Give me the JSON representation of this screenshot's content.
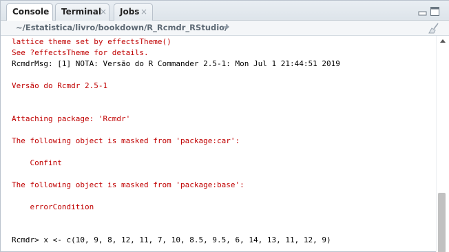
{
  "tabs": [
    {
      "label": "Console",
      "active": true
    },
    {
      "label": "Terminal",
      "close": "×"
    },
    {
      "label": "Jobs",
      "close": "×"
    }
  ],
  "path": "~/Estatistica/livro/bookdown/R_Rcmdr_RStudio/",
  "icons": {
    "minimize": "minimize-pane-icon",
    "maximize": "maximize-pane-icon",
    "go_to_dir": "arrow-right-icon",
    "clear_console": "broom-icon"
  },
  "colors": {
    "error_text": "#c00000",
    "normal_text": "#000000",
    "path_text": "#5e6a75"
  },
  "console_lines": [
    {
      "text": "lattice theme set by effectsTheme()",
      "type": "err"
    },
    {
      "text": "See ?effectsTheme for details.",
      "type": "err"
    },
    {
      "text": "RcmdrMsg: [1] NOTA: Versão do R Commander 2.5-1: Mon Jul 1 21:44:51 2019",
      "type": "out"
    },
    {
      "text": "Versão do Rcmdr 2.5-1",
      "type": "err"
    },
    {
      "text": "Attaching package: 'Rcmdr'",
      "type": "err"
    },
    {
      "text": "The following object is masked from 'package:car':",
      "type": "err"
    },
    {
      "text": "    Confint",
      "type": "err"
    },
    {
      "text": "The following object is masked from 'package:base':",
      "type": "err"
    },
    {
      "text": "    errorCondition",
      "type": "err"
    },
    {
      "text": "Rcmdr> x <- c(10, 9, 8, 12, 11, 7, 10, 8.5, 9.5, 6, 14, 13, 11, 12, 9)",
      "type": "out"
    }
  ]
}
